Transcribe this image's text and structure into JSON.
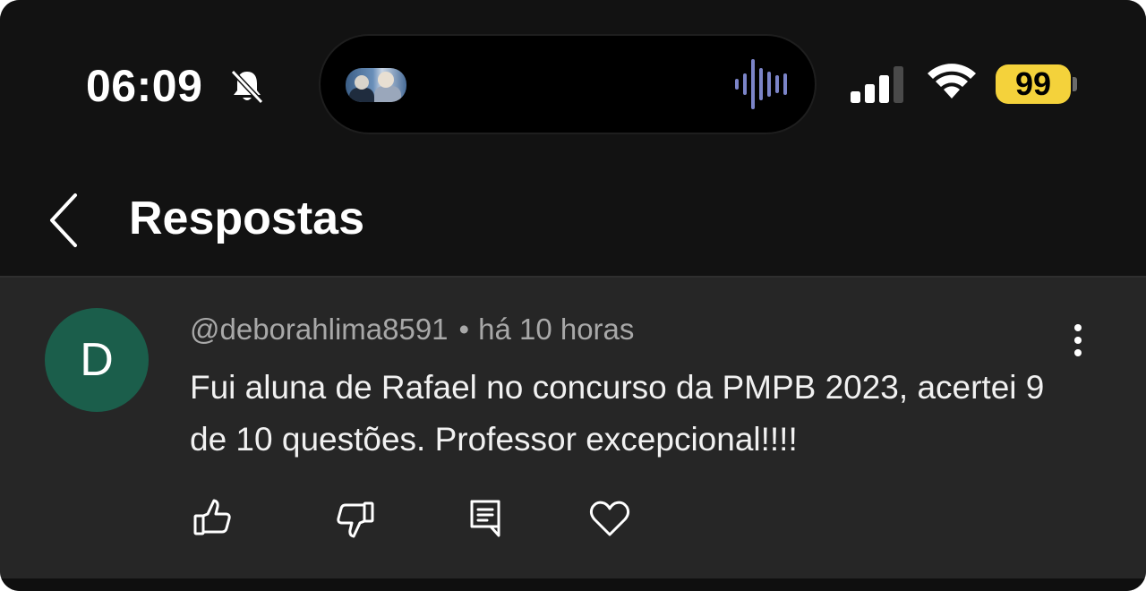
{
  "status_bar": {
    "time": "06:09",
    "battery": "99",
    "icons": [
      "bell-slash-icon",
      "waveform-icon",
      "signal-icon",
      "wifi-icon",
      "battery-icon"
    ],
    "battery_color": "#f4d23b"
  },
  "header": {
    "title": "Respostas",
    "back_icon": "chevron-left-icon"
  },
  "comment": {
    "avatar_letter": "D",
    "avatar_color": "#1b5e4b",
    "author": "@deborahlima8591",
    "separator": "•",
    "time": "há 10 horas",
    "text": "Fui aluna de Rafael no concurso da PMPB 2023, acertei 9 de 10 questões. Professor excepcional!!!!",
    "actions": [
      "thumbs-up-icon",
      "thumbs-down-icon",
      "reply-icon",
      "heart-icon"
    ],
    "more_icon": "more-vertical-icon"
  }
}
